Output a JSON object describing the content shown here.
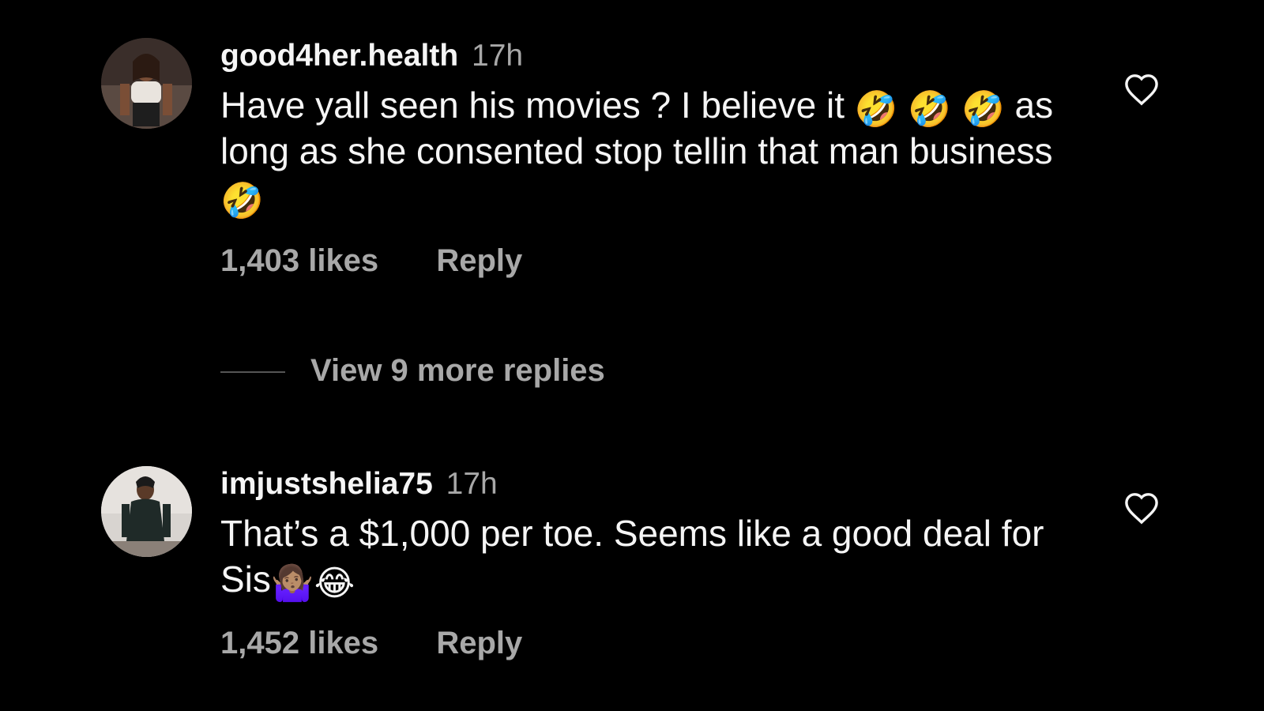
{
  "comments": [
    {
      "username": "good4her.health",
      "time": "17h",
      "text_1": "Have yall seen his movies ? I believe it ",
      "emoji_1": "🤣",
      "emoji_2": "🤣",
      "emoji_3": "🤣",
      "text_2": " as long as she consented stop tellin that man business ",
      "emoji_4": "🤣",
      "likes": "1,403 likes",
      "reply": "Reply",
      "avatar_icon": "profile-photo-icon",
      "like_icon": "heart-outline-icon"
    },
    {
      "username": "imjustshelia75",
      "time": "17h",
      "text_1": "That’s a $1,000 per toe. Seems like a good deal for Sis",
      "emoji_1": "🤷🏽‍♀️",
      "emoji_2": "😂",
      "likes": "1,452 likes",
      "reply": "Reply",
      "avatar_icon": "profile-photo-icon",
      "like_icon": "heart-outline-icon"
    }
  ],
  "view_replies": "View 9 more replies",
  "colors": {
    "background": "#000000",
    "primary_text": "#f5f5f5",
    "secondary_text": "#a8a8a8"
  }
}
